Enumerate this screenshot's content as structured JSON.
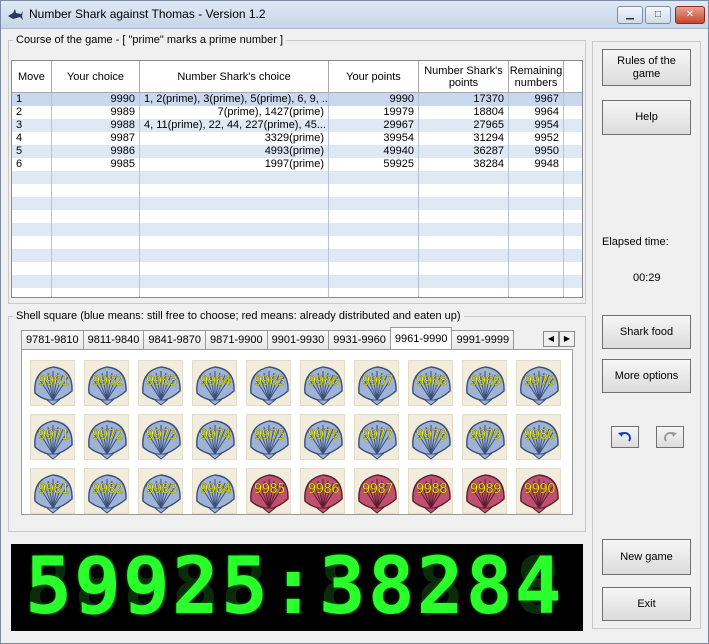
{
  "window": {
    "title": "Number Shark against Thomas - Version 1.2"
  },
  "course": {
    "legend": "Course of the game -  [ \"prime\" marks a prime number ]",
    "headers": [
      "Move",
      "Your choice",
      "Number Shark's choice",
      "Your points",
      "Number Shark's points",
      "Remaining numbers"
    ],
    "rows": [
      [
        "1",
        "9990",
        "1, 2(prime), 3(prime), 5(prime), 6, 9, ...",
        "9990",
        "17370",
        "9967"
      ],
      [
        "2",
        "9989",
        "7(prime), 1427(prime)",
        "19979",
        "18804",
        "9964"
      ],
      [
        "3",
        "9988",
        "4, 11(prime), 22, 44, 227(prime), 45...",
        "29967",
        "27965",
        "9954"
      ],
      [
        "4",
        "9987",
        "3329(prime)",
        "39954",
        "31294",
        "9952"
      ],
      [
        "5",
        "9986",
        "4993(prime)",
        "49940",
        "36287",
        "9950"
      ],
      [
        "6",
        "9985",
        "1997(prime)",
        "59925",
        "38284",
        "9948"
      ]
    ]
  },
  "shell": {
    "legend": "Shell square  (blue means: still free to choose;  red means: already distributed and eaten up)",
    "tabs": [
      "9781-9810",
      "9811-9840",
      "9841-9870",
      "9871-9900",
      "9901-9930",
      "9931-9960",
      "9961-9990",
      "9991-9999"
    ],
    "active_tab": "9961-9990",
    "cells": [
      {
        "n": "9961",
        "state": "free"
      },
      {
        "n": "9962",
        "state": "free"
      },
      {
        "n": "9963",
        "state": "free"
      },
      {
        "n": "9964",
        "state": "free"
      },
      {
        "n": "9965",
        "state": "free"
      },
      {
        "n": "9966",
        "state": "free"
      },
      {
        "n": "9967",
        "state": "free"
      },
      {
        "n": "9968",
        "state": "free"
      },
      {
        "n": "9969",
        "state": "free"
      },
      {
        "n": "9970",
        "state": "free"
      },
      {
        "n": "9971",
        "state": "free"
      },
      {
        "n": "9972",
        "state": "free"
      },
      {
        "n": "9973",
        "state": "free"
      },
      {
        "n": "9974",
        "state": "free"
      },
      {
        "n": "9975",
        "state": "free"
      },
      {
        "n": "9976",
        "state": "free"
      },
      {
        "n": "9977",
        "state": "free"
      },
      {
        "n": "9978",
        "state": "free"
      },
      {
        "n": "9979",
        "state": "free"
      },
      {
        "n": "9980",
        "state": "free"
      },
      {
        "n": "9981",
        "state": "free"
      },
      {
        "n": "9982",
        "state": "free"
      },
      {
        "n": "9983",
        "state": "free"
      },
      {
        "n": "9984",
        "state": "free"
      },
      {
        "n": "9985",
        "state": "eaten"
      },
      {
        "n": "9986",
        "state": "eaten"
      },
      {
        "n": "9987",
        "state": "eaten"
      },
      {
        "n": "9988",
        "state": "eaten"
      },
      {
        "n": "9989",
        "state": "eaten"
      },
      {
        "n": "9990",
        "state": "eaten"
      }
    ]
  },
  "score_display": "59925:38284",
  "side": {
    "rules_label": "Rules of the game",
    "help_label": "Help",
    "elapsed_label": "Elapsed time:",
    "elapsed_value": "00:29",
    "shark_food_label": "Shark food",
    "more_options_label": "More options",
    "new_game_label": "New game",
    "exit_label": "Exit"
  },
  "colors": {
    "lcd_on": "#2bff2b",
    "lcd_bg": "#000000",
    "shell_free": "#9fb3d6",
    "shell_eaten": "#c05070",
    "shell_number": "#ffff00"
  }
}
